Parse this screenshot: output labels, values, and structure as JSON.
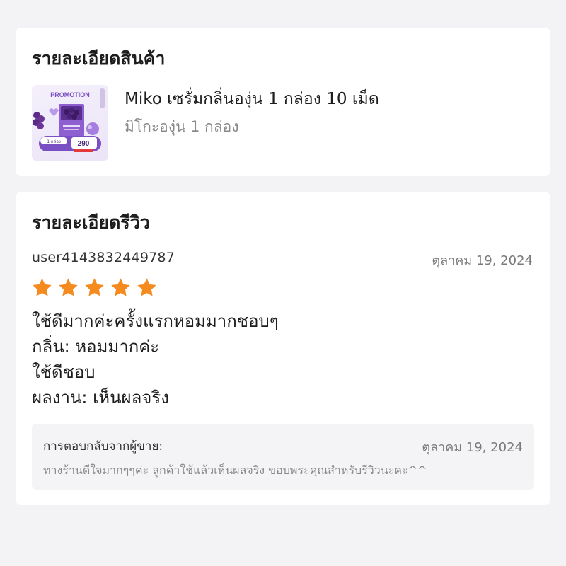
{
  "product_section": {
    "title": "รายละเอียดสินค้า",
    "product_name": "Miko เซรั่มกลิ่นองุ่น 1 กล่อง 10 เม็ด",
    "variant": "มิโกะองุ่น 1 กล่อง",
    "thumbnail": {
      "icon": "product-image",
      "badge_text": "PROMOTION",
      "pill_left": "1 กล่อง",
      "price": "290"
    }
  },
  "review_section": {
    "title": "รายละเอียดรีวิว",
    "username": "user4143832449787",
    "date": "ตุลาคม 19, 2024",
    "rating": 5,
    "rating_max": 5,
    "star_color": "#f58a1f",
    "body_lines": [
      "ใช้ดีมากค่ะครั้งแรกหอมมากชอบๆ",
      "กลิ่น: หอมมากค่ะ",
      "ใช้ดีชอบ",
      "ผลงาน: เห็นผลจริง"
    ],
    "seller_reply": {
      "label": "การตอบกลับจากผู้ขาย:",
      "date": "ตุลาคม 19, 2024",
      "text": "ทางร้านดีใจมากๆๆค่ะ ลูกค้าใช้แล้วเห็นผลจริง ขอบพระคุณสำหรับรีวิวนะคะ^^"
    }
  }
}
